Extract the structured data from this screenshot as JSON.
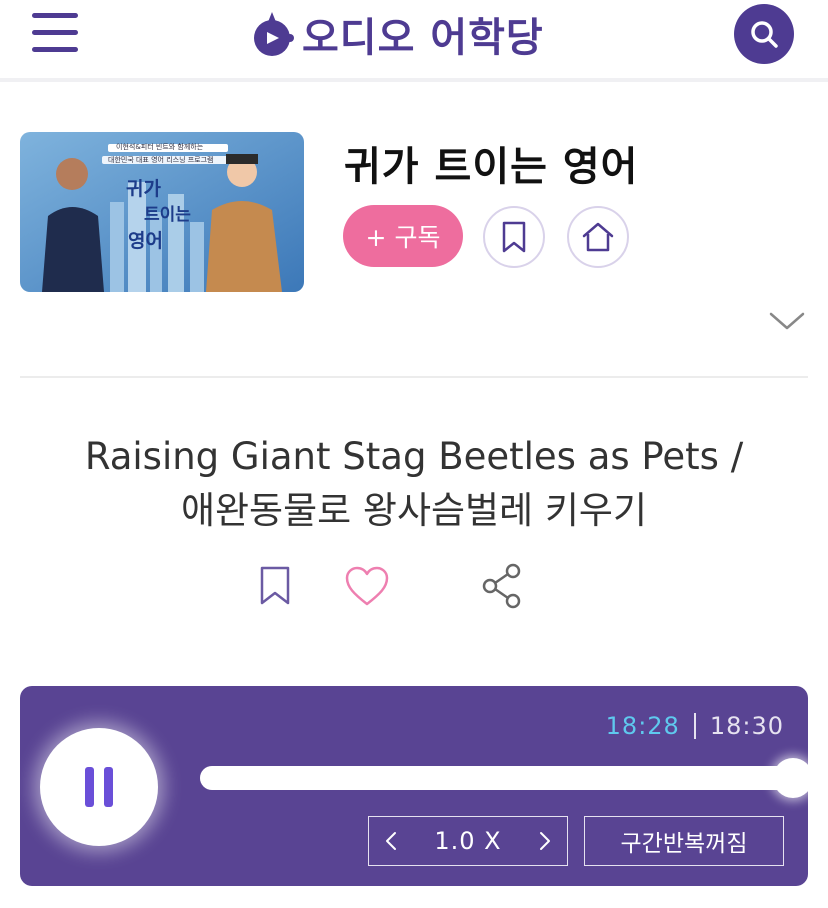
{
  "header": {
    "logo_text": "오디오 어학당",
    "menu_icon": "hamburger-menu-icon",
    "search_icon": "search-icon"
  },
  "program": {
    "title": "귀가 트이는 영어",
    "thumbnail": {
      "tagline": "이현석&피터 빈트와 함께하는",
      "subtitle": "대한민국 대표 영어 리스닝 프로그램",
      "logo_line1": "귀가",
      "logo_line2": "트이는",
      "logo_line3": "영어"
    },
    "subscribe_label": "+ 구독",
    "bookmark_icon": "bookmark-icon",
    "home_icon": "home-icon",
    "expand_icon": "chevron-down-icon"
  },
  "episode": {
    "title_line1": "Raising Giant Stag Beetles as Pets /",
    "title_line2": "애완동물로 왕사슴벌레 키우기",
    "actions": [
      "bookmark-icon",
      "heart-icon",
      "share-icon"
    ]
  },
  "player": {
    "state": "playing",
    "current_time": "18:28",
    "total_time": "18:30",
    "progress": 0.998,
    "speed_label": "1.0 X",
    "repeat_label": "구간반복꺼짐",
    "colors": {
      "panel": "#594493",
      "current_time": "#5fc9ee",
      "pause_icon": "#6a4fd8"
    }
  },
  "colors": {
    "brand": "#4e3b92",
    "subscribe": "#ee6d9e"
  }
}
